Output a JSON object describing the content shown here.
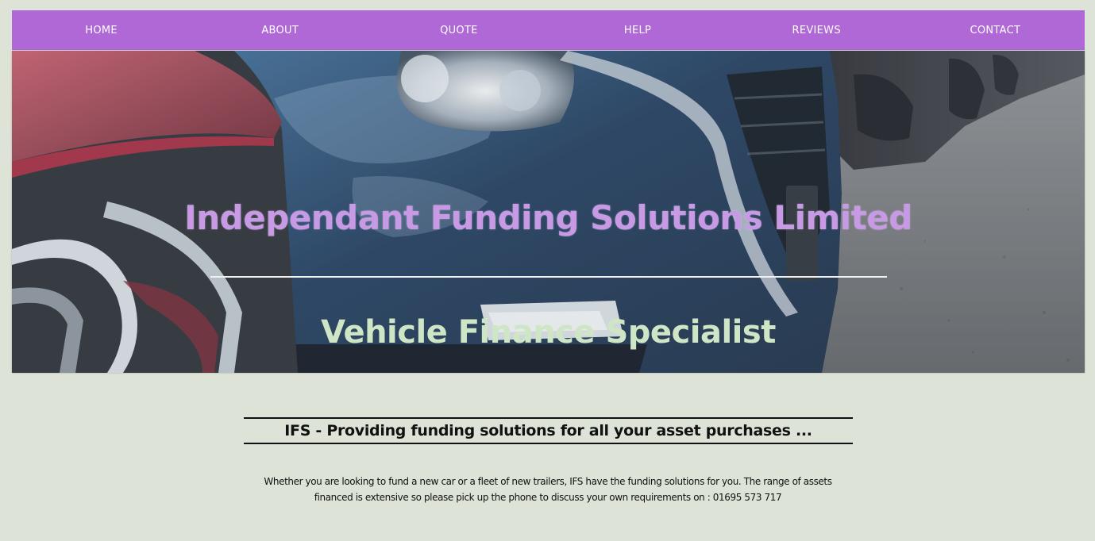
{
  "nav": {
    "items": [
      {
        "label": "HOME"
      },
      {
        "label": "ABOUT"
      },
      {
        "label": "QUOTE"
      },
      {
        "label": "HELP"
      },
      {
        "label": "REVIEWS"
      },
      {
        "label": "CONTACT"
      }
    ]
  },
  "hero": {
    "title": "Independant Funding Solutions Limited",
    "subtitle": "Vehicle Finance Specialist",
    "image_description": "hero-car-photo"
  },
  "main": {
    "headline": "IFS - Providing funding solutions for all your asset purchases ...",
    "intro_line1": "Whether you are looking to fund a new car or a fleet of new trailers, IFS have the funding solutions for you. The range of assets",
    "intro_line2": "financed is extensive so please pick up the phone to discuss your own requirements on : 01695 573 717"
  },
  "colors": {
    "background": "#dde3d6",
    "nav_bg": "#b068d6",
    "title_purple": "#c89ae6",
    "subtitle_green": "#cfe6c6"
  }
}
